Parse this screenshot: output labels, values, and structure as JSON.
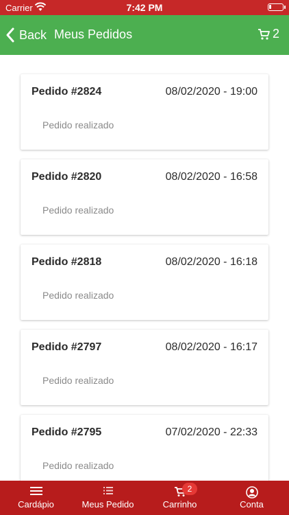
{
  "status_bar": {
    "carrier": "Carrier",
    "time": "7:42 PM"
  },
  "navbar": {
    "back_label": "Back",
    "title": "Meus Pedidos",
    "cart_count": "2"
  },
  "orders": [
    {
      "title": "Pedido #2824",
      "date": "08/02/2020 - 19:00",
      "status": "Pedido realizado"
    },
    {
      "title": "Pedido #2820",
      "date": "08/02/2020 - 16:58",
      "status": "Pedido realizado"
    },
    {
      "title": "Pedido #2818",
      "date": "08/02/2020 - 16:18",
      "status": "Pedido realizado"
    },
    {
      "title": "Pedido #2797",
      "date": "08/02/2020 - 16:17",
      "status": "Pedido realizado"
    },
    {
      "title": "Pedido #2795",
      "date": "07/02/2020 - 22:33",
      "status": "Pedido realizado"
    }
  ],
  "tabbar": {
    "items": [
      {
        "label": "Cardápio",
        "icon": "menu-icon"
      },
      {
        "label": "Meus Pedido",
        "icon": "list-icon"
      },
      {
        "label": "Carrinho",
        "icon": "cart-icon",
        "badge": "2"
      },
      {
        "label": "Conta",
        "icon": "account-icon"
      }
    ]
  },
  "colors": {
    "header": "#4caf50",
    "status_bar": "#c62828",
    "tabbar": "#b71c1c",
    "badge": "#e53935"
  }
}
